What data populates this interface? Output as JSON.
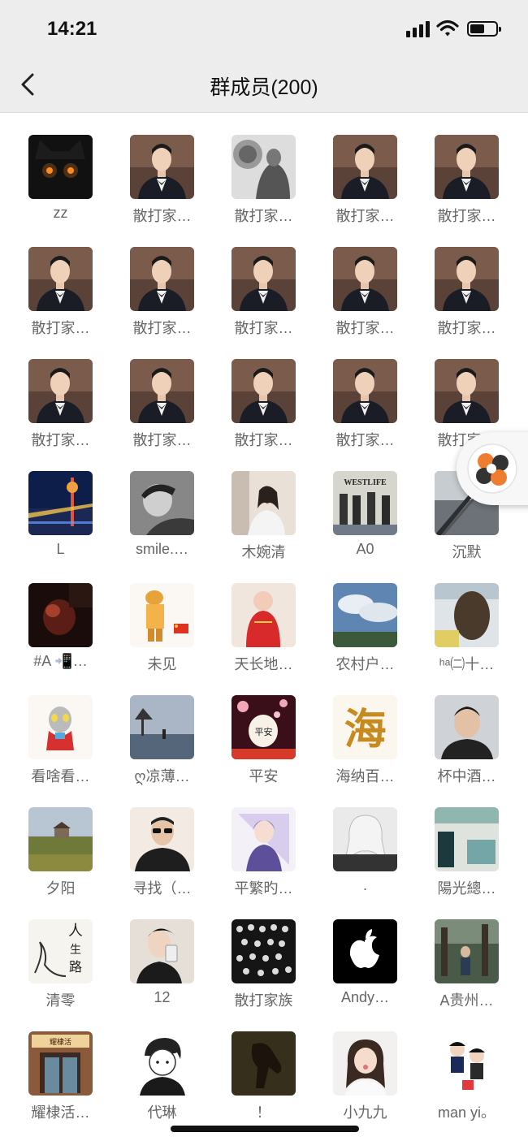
{
  "status_bar": {
    "time": "14:21"
  },
  "nav": {
    "title": "群成员(200)"
  },
  "icons": {
    "back": "chevron-left-icon",
    "signal": "cellular-signal-icon",
    "wifi": "wifi-icon",
    "battery": "battery-icon",
    "floating": "floating-assistant-icon"
  },
  "members": [
    {
      "name": "zz",
      "avatar": "black-cat"
    },
    {
      "name": "散打家…",
      "avatar": "man-in-suit"
    },
    {
      "name": "散打家…",
      "avatar": "bw-photo"
    },
    {
      "name": "散打家…",
      "avatar": "man-in-suit"
    },
    {
      "name": "散打家…",
      "avatar": "man-in-suit"
    },
    {
      "name": "散打家…",
      "avatar": "man-in-suit"
    },
    {
      "name": "散打家…",
      "avatar": "man-in-suit"
    },
    {
      "name": "散打家…",
      "avatar": "man-in-suit"
    },
    {
      "name": "散打家…",
      "avatar": "man-in-suit"
    },
    {
      "name": "散打家…",
      "avatar": "man-in-suit"
    },
    {
      "name": "散打家…",
      "avatar": "man-in-suit"
    },
    {
      "name": "散打家…",
      "avatar": "man-in-suit"
    },
    {
      "name": "散打家…",
      "avatar": "man-in-suit"
    },
    {
      "name": "散打家…",
      "avatar": "man-in-suit"
    },
    {
      "name": "散打家…",
      "avatar": "man-in-suit"
    },
    {
      "name": "L",
      "avatar": "night-tower"
    },
    {
      "name": "smile.…",
      "avatar": "bw-portrait"
    },
    {
      "name": "木婉清",
      "avatar": "girl-room"
    },
    {
      "name": "A0",
      "avatar": "album-cover"
    },
    {
      "name": "沉默",
      "avatar": "railing"
    },
    {
      "name": "#A 📲…",
      "avatar": "dark-red"
    },
    {
      "name": "未见",
      "avatar": "firefighter"
    },
    {
      "name": "天长地…",
      "avatar": "baby-red"
    },
    {
      "name": "农村户…",
      "avatar": "sky-clouds"
    },
    {
      "name": "ʰᵃ㈡十…",
      "avatar": "hair-back"
    },
    {
      "name": "看啥看…",
      "avatar": "ultraman"
    },
    {
      "name": "ღ凉薄…",
      "avatar": "lakeside"
    },
    {
      "name": "平安",
      "avatar": "lantern"
    },
    {
      "name": "海纳百…",
      "avatar": "calligraphy"
    },
    {
      "name": "杯中酒…",
      "avatar": "young-man"
    },
    {
      "name": "夕阳",
      "avatar": "landscape"
    },
    {
      "name": "寻找（…",
      "avatar": "sunglasses-man"
    },
    {
      "name": "平繁旳…",
      "avatar": "anime-purple"
    },
    {
      "name": ".",
      "avatar": "bw-woman"
    },
    {
      "name": "陽光總…",
      "avatar": "teal-scene"
    },
    {
      "name": "清零",
      "avatar": "ink-art"
    },
    {
      "name": "12",
      "avatar": "selfie"
    },
    {
      "name": "散打家族",
      "avatar": "chandelier"
    },
    {
      "name": "Andy…",
      "avatar": "apple-logo"
    },
    {
      "name": "A贵州…",
      "avatar": "forest-man"
    },
    {
      "name": "耀棣活…",
      "avatar": "shop-front"
    },
    {
      "name": "代琳",
      "avatar": "anime-boy"
    },
    {
      "name": "！",
      "avatar": "horse"
    },
    {
      "name": "小九九",
      "avatar": "cute-girl"
    },
    {
      "name": "man yi。",
      "avatar": "cartoon-kids"
    }
  ],
  "avatar_text": {
    "calligraphy": "海",
    "lantern": "平安",
    "ink": "人生路",
    "shop": "耀棣活",
    "album": "WESTLIFE"
  }
}
